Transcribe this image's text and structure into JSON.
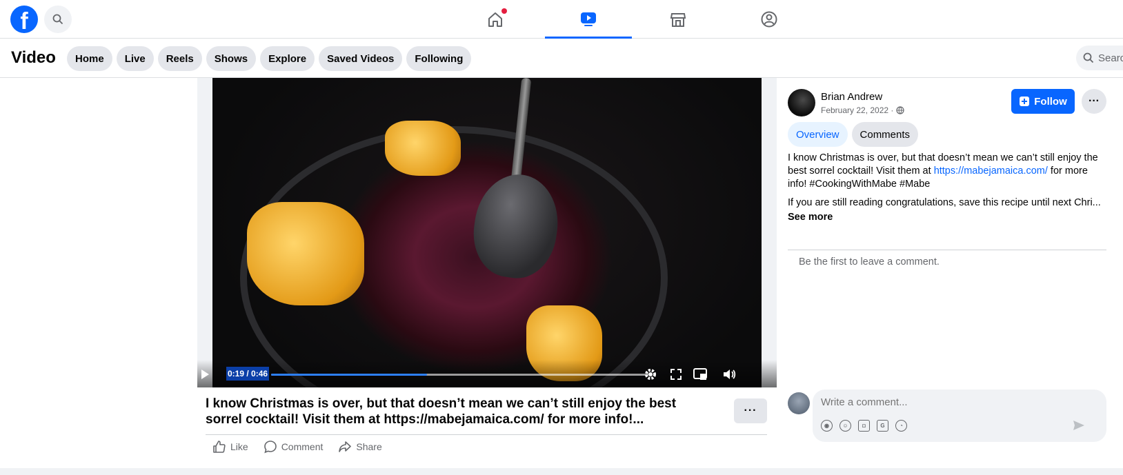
{
  "topbar": {
    "logo": "f",
    "icons": [
      "search-icon",
      "home-icon",
      "video-icon",
      "marketplace-icon",
      "groups-icon"
    ]
  },
  "subnav": {
    "title": "Video",
    "pills": [
      "Home",
      "Live",
      "Reels",
      "Shows",
      "Explore",
      "Saved Videos",
      "Following"
    ],
    "search_placeholder": "Search"
  },
  "player": {
    "time": "0:19 / 0:46",
    "progress": 0.413,
    "caption": "I know Christmas is over, but that doesn’t mean we can’t still enjoy the best sorrel cocktail! Visit them at https://mabejamaica.com/ for more info!...",
    "actions": {
      "like": "Like",
      "comment": "Comment",
      "share": "Share"
    }
  },
  "post": {
    "author": "Brian Andrew",
    "date": "February 22, 2022 ·",
    "follow": "Follow",
    "tabs": {
      "overview": "Overview",
      "comments": "Comments"
    },
    "desc1_a": "I know Christmas is over, but that doesn’t mean we can’t still enjoy the best sorrel cocktail! Visit them at ",
    "desc1_link": "https://mabejamaica.com/",
    "desc1_b": " for more info! #CookingWithMabe #Mabe",
    "desc2": "If you are still reading congratulations, save this recipe until next Chri...",
    "see_more": "See more",
    "empty_comments": "Be the first to leave a comment.",
    "comment_placeholder": "Write a comment..."
  },
  "colors": {
    "brand": "#0866ff",
    "notification": "#e41e3f"
  }
}
